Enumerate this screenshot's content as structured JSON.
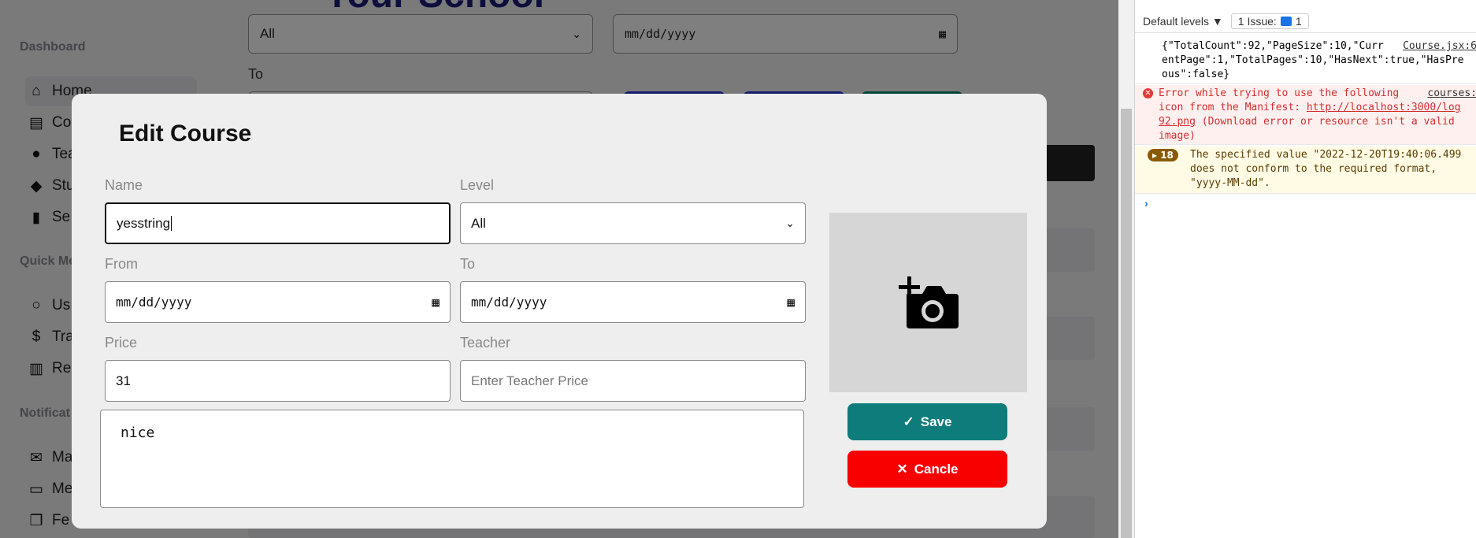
{
  "app": {
    "title_partial": "Your School",
    "sidebar": {
      "sections": [
        {
          "heading": "Dashboard",
          "items": [
            {
              "label": "Home",
              "icon": "home-icon",
              "glyph": "⌂",
              "active": true
            },
            {
              "label": "Co",
              "icon": "book-icon",
              "glyph": "▤"
            },
            {
              "label": "Tea",
              "icon": "user-icon",
              "glyph": "●"
            },
            {
              "label": "Stu",
              "icon": "users-icon",
              "glyph": "◆"
            },
            {
              "label": "Se",
              "icon": "door-icon",
              "glyph": "▮"
            }
          ]
        },
        {
          "heading": "Quick Me",
          "items": [
            {
              "label": "Us",
              "icon": "person-icon",
              "glyph": "○"
            },
            {
              "label": "Tra",
              "icon": "dollar-icon",
              "glyph": "$"
            },
            {
              "label": "Re",
              "icon": "bar-chart-icon",
              "glyph": "▥"
            }
          ]
        },
        {
          "heading": "Notificat",
          "items": [
            {
              "label": "Ma",
              "icon": "mail-icon",
              "glyph": "✉"
            },
            {
              "label": "Me",
              "icon": "message-icon",
              "glyph": "▭"
            },
            {
              "label": "Fe",
              "icon": "feedback-icon",
              "glyph": "❐"
            }
          ]
        }
      ]
    },
    "filters": {
      "level_value": "All",
      "from_value": "mm/dd/yyyy",
      "to_label": "To"
    }
  },
  "modal": {
    "title": "Edit Course",
    "name_label": "Name",
    "name_value": "yesstring",
    "level_label": "Level",
    "level_value": "All",
    "from_label": "From",
    "from_value": "mm/dd/yyyy",
    "to_label": "To",
    "to_value": "mm/dd/yyyy",
    "price_label": "Price",
    "price_value": "31",
    "teacher_label": "Teacher",
    "teacher_placeholder": "Enter Teacher Price",
    "description_value": "nice",
    "save_label": "Save",
    "cancel_label": "Cancle"
  },
  "devtools": {
    "levels_label": "Default levels ▼",
    "issues_label": "1 Issue:",
    "issues_count": "1",
    "log1_lines": [
      "{\"TotalCount\":92,\"PageSize\":10,\"Curr",
      "entPage\":1,\"TotalPages\":10,\"HasNext\":true,\"HasPre",
      "ous\":false}"
    ],
    "log1_source": "Course.jsx:6",
    "err_line1": "Error while trying to use the following",
    "err_line2": "icon from the Manifest: ",
    "err_link1": "http://localhost:3000/log",
    "err_link2": "92.png",
    "err_line3": " (Download error or resource isn't a valid",
    "err_line4": "image)",
    "err_source": "courses:",
    "warn_count": "18",
    "warn_line1": "The specified value \"2022-12-20T19:40:06.499",
    "warn_line2": "does not conform to the required format,",
    "warn_line3": "\"yyyy-MM-dd\".",
    "prompt": "›"
  },
  "colors": {
    "save": "#0e7c7b",
    "cancel": "#f90000",
    "title_blue": "#1c1c7a"
  }
}
